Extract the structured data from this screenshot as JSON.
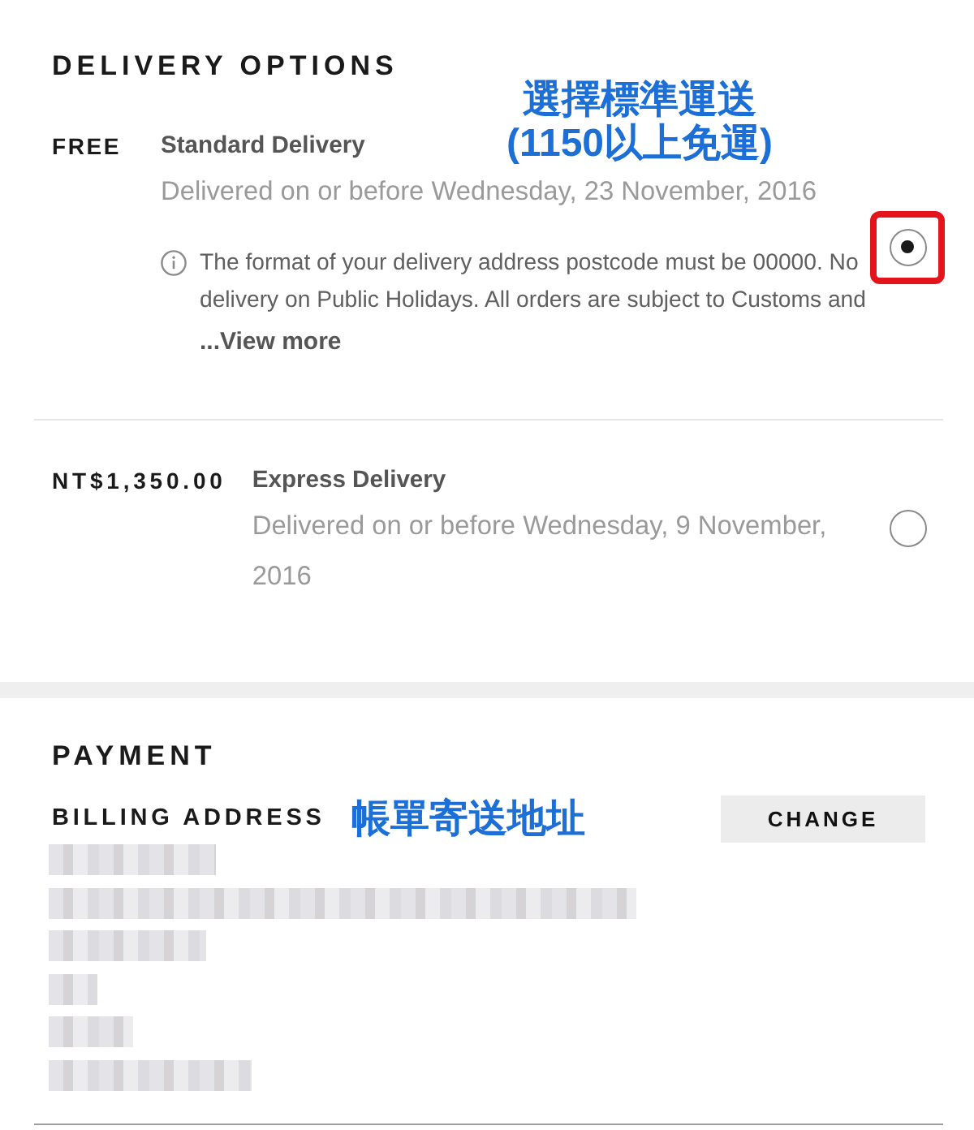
{
  "delivery": {
    "title": "DELIVERY OPTIONS",
    "options": [
      {
        "price": "FREE",
        "name": "Standard Delivery",
        "date": "Delivered on or before Wednesday, 23 November, 2016",
        "note": "The format of your delivery address postcode must be 00000. No delivery on Public Holidays. All orders are subject to Customs and",
        "more_link": "...View more",
        "selected": true,
        "highlighted": true,
        "annotation": [
          "選擇標準運送",
          "(1150以上免運)"
        ]
      },
      {
        "price": "NT$1,350.00",
        "name": "Express Delivery",
        "date": "Delivered on or before Wednesday, 9 November, 2016",
        "selected": false,
        "highlighted": false
      }
    ]
  },
  "payment": {
    "title": "PAYMENT",
    "billing_address": {
      "label": "BILLING ADDRESS",
      "annotation": "帳單寄送地址",
      "button": "CHANGE",
      "lines": [
        {
          "kind": "blurred"
        },
        {
          "kind": "blurred"
        },
        {
          "kind": "blurred"
        },
        {
          "kind": "blurred"
        },
        {
          "kind": "blurred"
        },
        {
          "kind": "blurred"
        }
      ]
    }
  }
}
